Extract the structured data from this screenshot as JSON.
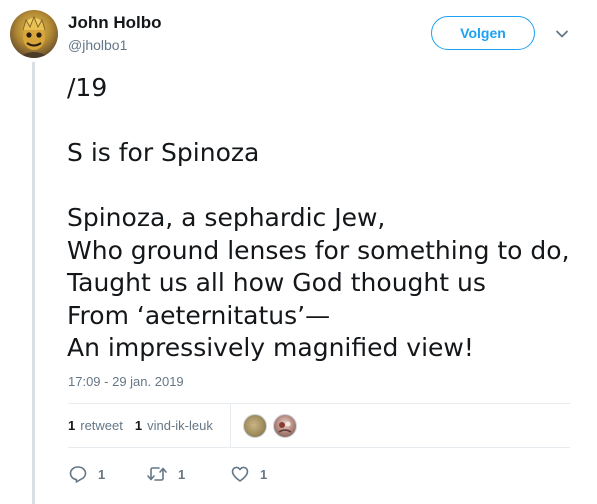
{
  "author": {
    "name": "John Holbo",
    "handle": "@jholbo1"
  },
  "follow_label": "Volgen",
  "tweet": {
    "lines": [
      "/19",
      "",
      "S is for Spinoza",
      "",
      "Spinoza, a sephardic Jew,",
      "Who ground lenses for something to do,",
      "Taught us all how God thought us",
      "From ‘aeternitatus’—",
      "An impressively magnified view!"
    ],
    "timestamp": "17:09 - 29 jan. 2019"
  },
  "stats": {
    "retweets_count": "1",
    "retweets_label": "retweet",
    "likes_count": "1",
    "likes_label": "vind-ik-leuk"
  },
  "actions": {
    "reply_count": "1",
    "retweet_count": "1",
    "like_count": "1"
  },
  "colors": {
    "accent": "#1da1f2",
    "muted_text": "#657786",
    "primary_text": "#14171a",
    "divider": "#e6ecf0"
  },
  "icons": {
    "more": "chevron-down-icon",
    "reply": "reply-icon",
    "retweet": "retweet-icon",
    "like": "heart-icon"
  }
}
